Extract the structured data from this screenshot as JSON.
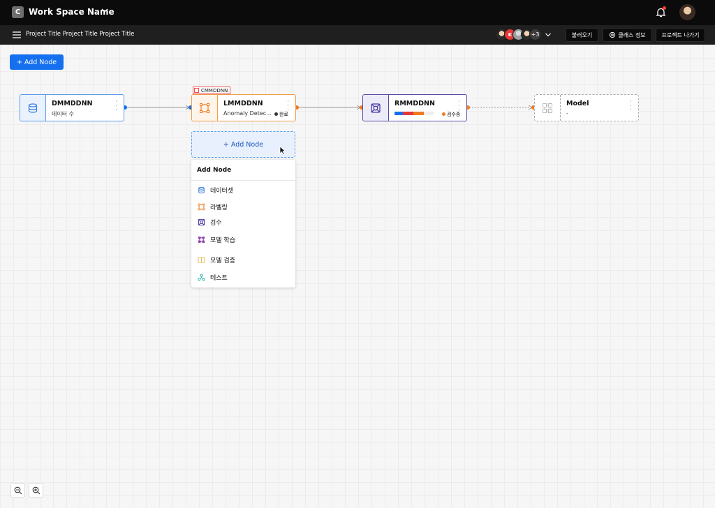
{
  "header": {
    "workspace_badge": "C",
    "workspace_name": "Work Space Name",
    "icons": [
      "chevron-down-icon",
      "bell-icon",
      "user-avatar"
    ]
  },
  "subheader": {
    "project_title": "Project Title Project Title Project Title",
    "avatar_initial": "K",
    "extra_members": "+3",
    "buttons": {
      "load": "불러오기",
      "class_info": "클래스 정보",
      "exit_project": "프로젝트 나가기"
    }
  },
  "canvas": {
    "add_node_button": "+ Add Node",
    "group_tag": "CMMDDNN",
    "nodes": [
      {
        "title": "DMMDDNN",
        "subtitle": "데이터 수",
        "icon": "database-icon",
        "color": "#5b9bea"
      },
      {
        "title": "LMMDDNN",
        "subtitle": "Anomaly Detec...",
        "status": "완료",
        "status_color": "#333333",
        "icon": "labeling-icon",
        "color": "#f39c4a"
      },
      {
        "title": "RMMDDNN",
        "status": "검수중",
        "status_color": "#f07b1f",
        "icon": "review-icon",
        "color": "#5a4aa8"
      },
      {
        "title": "Model",
        "subtitle": "-",
        "icon": "model-icon",
        "color": "#aaaaaa"
      }
    ],
    "add_node_slot": "+ Add Node",
    "menu": {
      "title": "Add Node",
      "items": [
        "데이터셋",
        "라벨링",
        "검수",
        "모델 학습",
        "모델 검증",
        "테스트"
      ]
    }
  },
  "colors": {
    "accent": "#1570ef",
    "dataset": "#5b9bea",
    "labeling": "#f39c4a",
    "review": "#5a4aa8",
    "training": "#8e44ad",
    "validation": "#e6b84a",
    "test": "#2bb5a8"
  }
}
